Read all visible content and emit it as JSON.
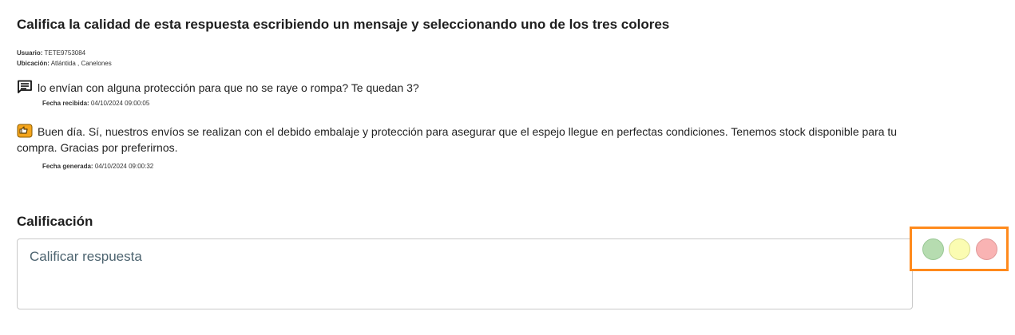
{
  "heading": "Califica la calidad de esta respuesta escribiendo un mensaje y seleccionando uno de los tres colores",
  "meta": {
    "user_label": "Usuario:",
    "user_value": "TETE9753084",
    "location_label": "Ubicación:",
    "location_value": "Atlántida , Canelones"
  },
  "received": {
    "icon": "message-icon",
    "text": "lo envían con alguna protección para que no se raye o rompa? Te quedan 3?",
    "date_label": "Fecha recibida:",
    "date_value": "04/10/2024 09:00:05"
  },
  "generated": {
    "icon": "bot-reply-icon",
    "text": "Buen día. Sí, nuestros envíos se realizan con el debido embalaje y protección para asegurar que el espejo llegue en perfectas condiciones. Tenemos stock disponible para tu compra. Gracias por preferirnos.",
    "date_label": "Fecha generada:",
    "date_value": "04/10/2024 09:00:32"
  },
  "rating": {
    "title": "Calificación",
    "placeholder": "Calificar respuesta",
    "value": ""
  },
  "colors": {
    "highlight": "#ff8a1c",
    "options": [
      {
        "name": "green",
        "fill": "#b6dcb0",
        "border": "#98c794"
      },
      {
        "name": "yellow",
        "fill": "#fbfcb2",
        "border": "#d8da8e"
      },
      {
        "name": "red",
        "fill": "#f9b3b3",
        "border": "#e09898"
      }
    ]
  }
}
